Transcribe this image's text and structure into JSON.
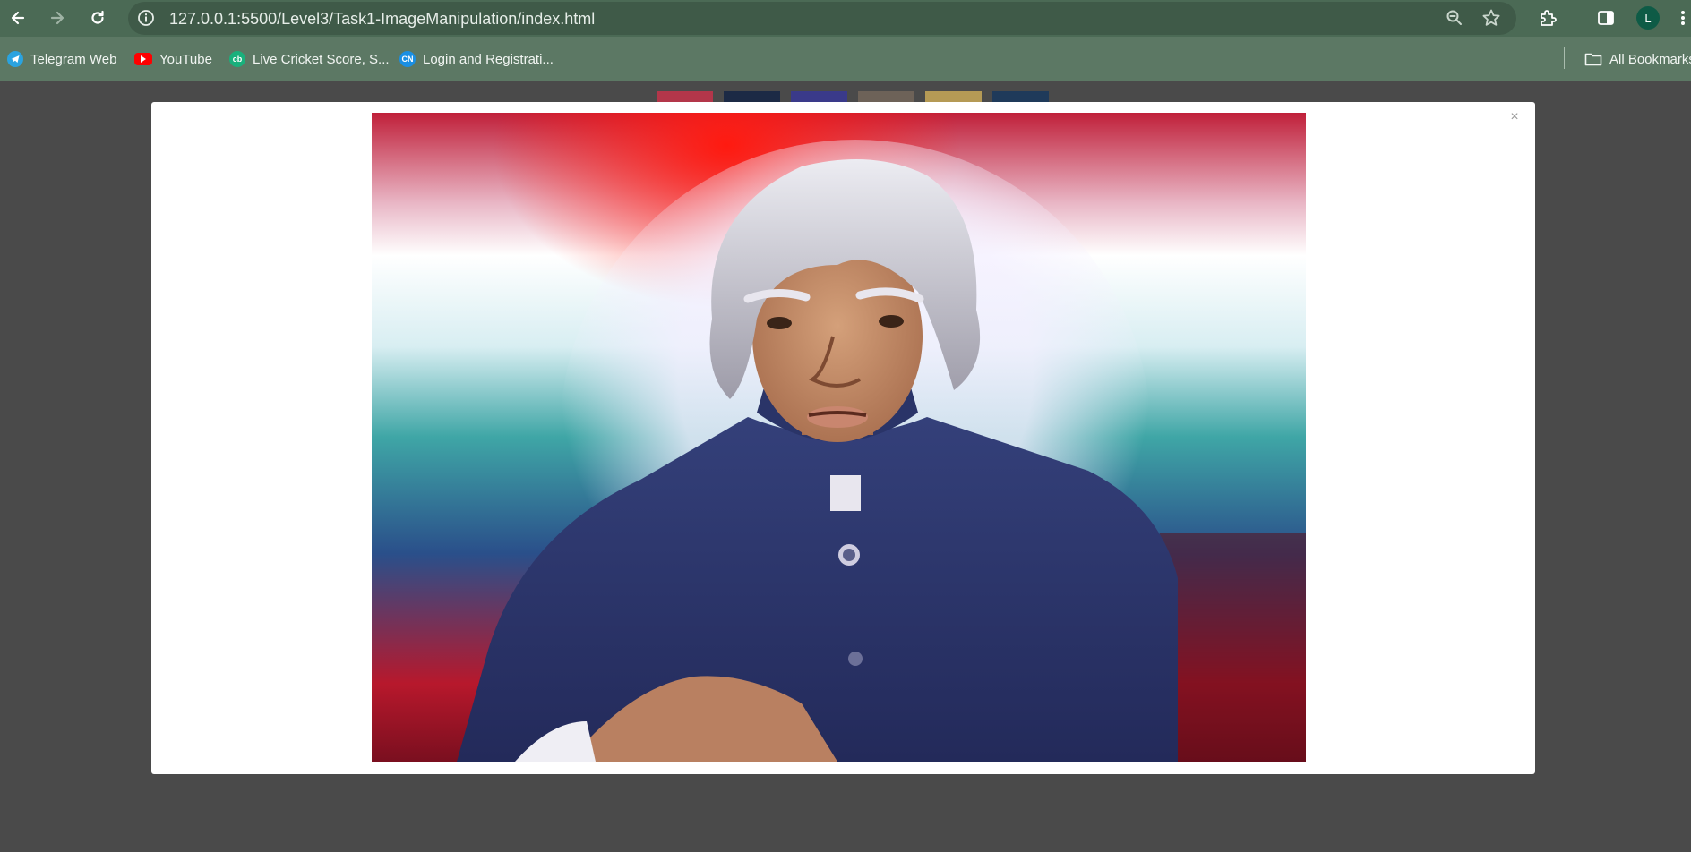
{
  "browser": {
    "url": "127.0.0.1:5500/Level3/Task1-ImageManipulation/index.html",
    "profile_initial": "L",
    "bookmarks": [
      {
        "label": "Telegram Web",
        "icon": "telegram-icon",
        "color": "#2aa3e0"
      },
      {
        "label": "YouTube",
        "icon": "youtube-icon",
        "color": "#ff0000"
      },
      {
        "label": "Live Cricket Score, S...",
        "icon": "cricbuzz-icon",
        "color": "#19b07c"
      },
      {
        "label": "Login and Registrati...",
        "icon": "codingninjas-icon",
        "color": "#1a8fe3"
      }
    ],
    "all_bookmarks_label": "All Bookmarks"
  },
  "gallery": {
    "thumbnail_colors": [
      "#b3364a",
      "#1c2a45",
      "#3a3a8a",
      "#6d6258",
      "#b59a55",
      "#1f3a5a"
    ]
  },
  "modal": {
    "close_label": "×",
    "photo_icon": "portrait-photo"
  },
  "colors": {
    "toolbar": "#4b6a55",
    "bookmarks_bar": "#5c7864",
    "page_background": "#4a4a4a",
    "modal_background": "#ffffff"
  }
}
